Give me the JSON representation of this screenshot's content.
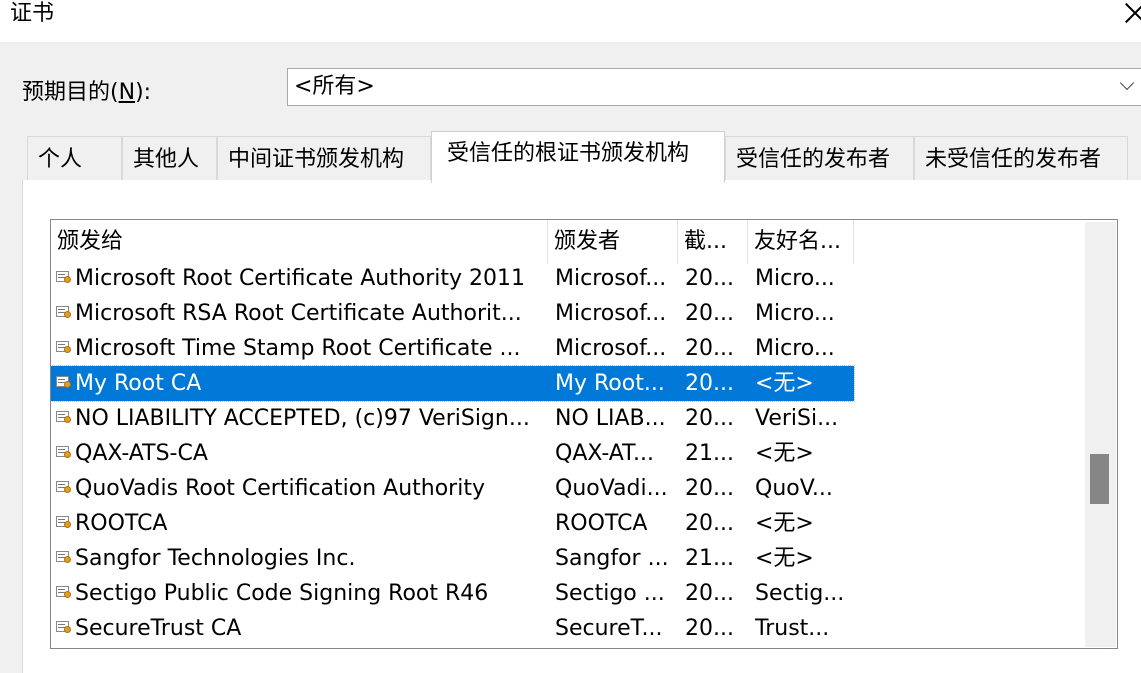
{
  "window": {
    "title": "证书"
  },
  "purpose": {
    "label_pre": "预期目的(",
    "label_key": "N",
    "label_post": "):",
    "value": "<所有>"
  },
  "tabs": [
    {
      "label": "个人"
    },
    {
      "label": "其他人"
    },
    {
      "label": "中间证书颁发机构"
    },
    {
      "label": "受信任的根证书颁发机构",
      "active": true
    },
    {
      "label": "受信任的发布者"
    },
    {
      "label": "未受信任的发布者"
    }
  ],
  "list": {
    "columns": [
      "颁发给",
      "颁发者",
      "截...",
      "友好名..."
    ],
    "rows": [
      [
        "Microsoft Root Certificate Authority 2011",
        "Microsof...",
        "20...",
        "Micro..."
      ],
      [
        "Microsoft RSA Root Certificate Authorit...",
        "Microsof...",
        "20...",
        "Micro..."
      ],
      [
        "Microsoft Time Stamp Root Certificate ...",
        "Microsof...",
        "20...",
        "Micro..."
      ],
      [
        "My Root CA",
        "My Root...",
        "20...",
        "<无>"
      ],
      [
        "NO LIABILITY ACCEPTED, (c)97 VeriSign...",
        "NO LIAB...",
        "20...",
        "VeriSi..."
      ],
      [
        "QAX-ATS-CA",
        "QAX-AT...",
        "21...",
        "<无>"
      ],
      [
        "QuoVadis Root Certification Authority",
        "QuoVadi...",
        "20...",
        "QuoV..."
      ],
      [
        "ROOTCA",
        "ROOTCA",
        "20...",
        "<无>"
      ],
      [
        "Sangfor Technologies Inc.",
        "Sangfor ...",
        "21...",
        "<无>"
      ],
      [
        "Sectigo Public Code Signing Root R46",
        "Sectigo ...",
        "20...",
        "Sectig..."
      ],
      [
        "SecureTrust CA",
        "SecureT...",
        "20...",
        "Trust..."
      ]
    ],
    "selected_row": "My Root CA"
  },
  "colors": {
    "selection": "#0078d7",
    "background": "#f0f0f0",
    "scroll_thumb": "#868686"
  }
}
